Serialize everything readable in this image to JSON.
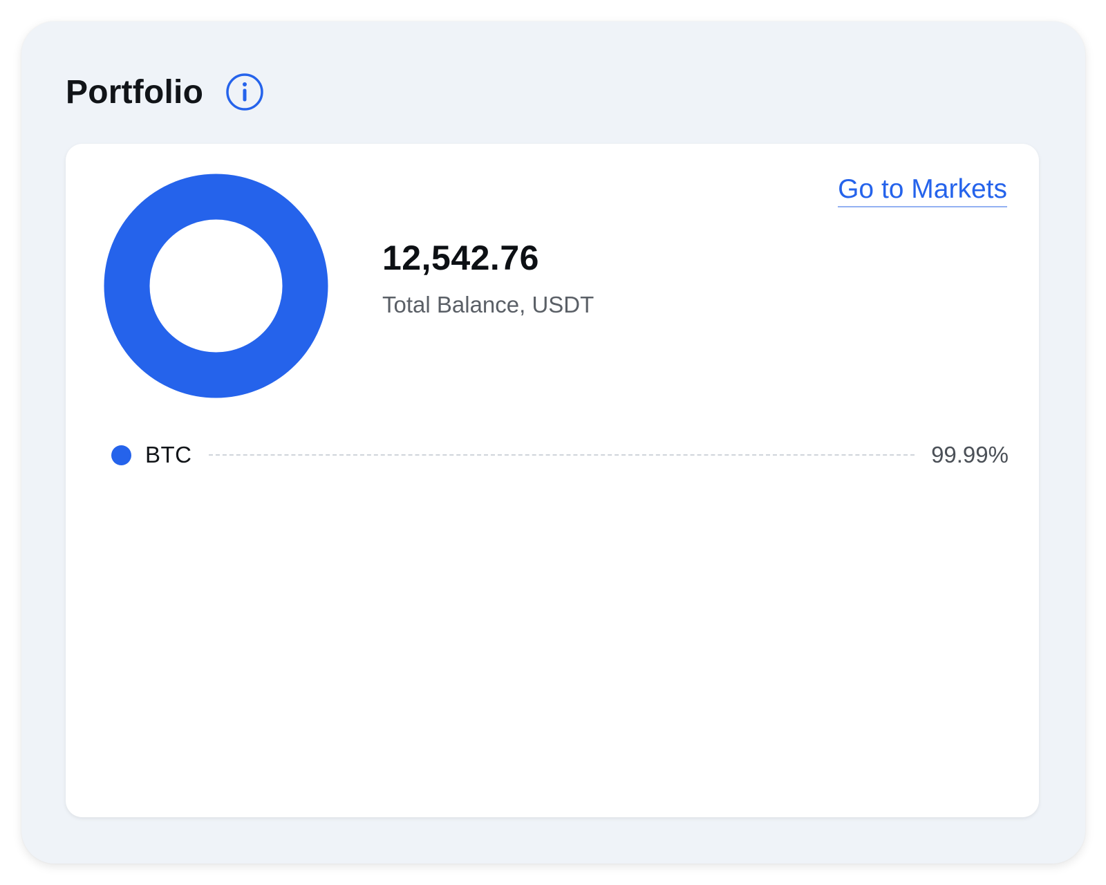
{
  "portfolio": {
    "title": "Portfolio",
    "info_icon": "info-icon",
    "total_balance": "12,542.76",
    "total_balance_label": "Total Balance, USDT",
    "go_to_markets_label": "Go to Markets"
  },
  "colors": {
    "accent": "#2563eb",
    "panel_background": "#eff3f8",
    "card_background": "#ffffff"
  },
  "chart_data": {
    "type": "pie",
    "categories": [
      "BTC"
    ],
    "values": [
      99.99
    ],
    "value_labels": [
      "99.99%"
    ],
    "colors": [
      "#2563eb"
    ],
    "donut": true,
    "legend": "below"
  }
}
